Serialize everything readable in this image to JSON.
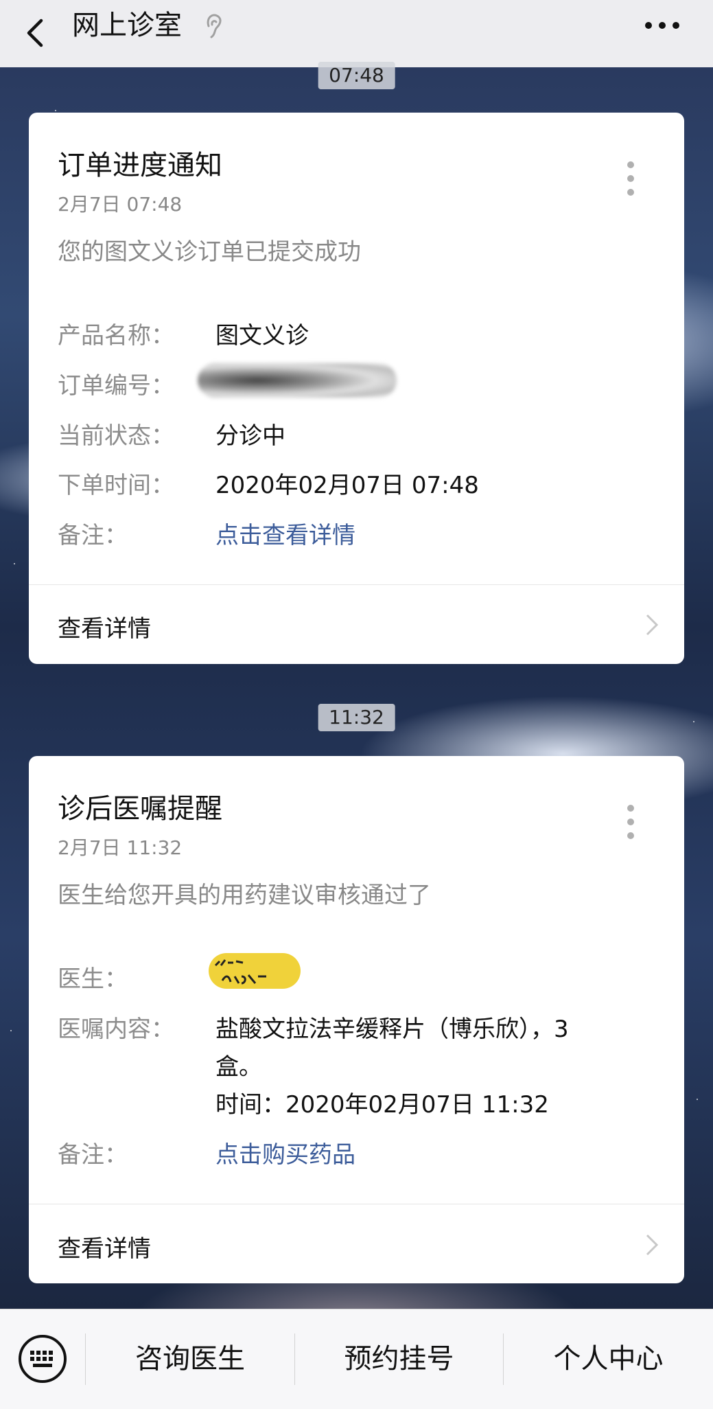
{
  "header": {
    "title": "网上诊室"
  },
  "messages": [
    {
      "time_badge": "07:48",
      "title": "订单进度通知",
      "date": "2月7日  07:48",
      "description": "您的图文义诊订单已提交成功",
      "rows": [
        {
          "label": "产品名称：",
          "value": "图文义诊"
        },
        {
          "label": "订单编号：",
          "value": ""
        },
        {
          "label": "当前状态：",
          "value": "分诊中"
        },
        {
          "label": "下单时间：",
          "value": "2020年02月07日 07:48"
        },
        {
          "label": "备注：",
          "value": "点击查看详情"
        }
      ],
      "footer": "查看详情"
    },
    {
      "time_badge": "11:32",
      "title": "诊后医嘱提醒",
      "date": "2月7日  11:32",
      "description": "医生给您开具的用药建议审核通过了",
      "rows": [
        {
          "label": "医生：",
          "value": ""
        },
        {
          "label": "医嘱内容：",
          "value_lines": [
            "盐酸文拉法辛缓释片（博乐欣），3",
            "盒。",
            "时间：2020年02月07日 11:32"
          ]
        },
        {
          "label": "备注：",
          "value": "点击购买药品"
        }
      ],
      "footer": "查看详情"
    }
  ],
  "bottom_menu": {
    "items": [
      "咨询医生",
      "预约挂号",
      "个人中心"
    ]
  },
  "colors": {
    "link": "#3c5c9a",
    "header_bg": "#ededf0",
    "card_bg": "#ffffff"
  }
}
